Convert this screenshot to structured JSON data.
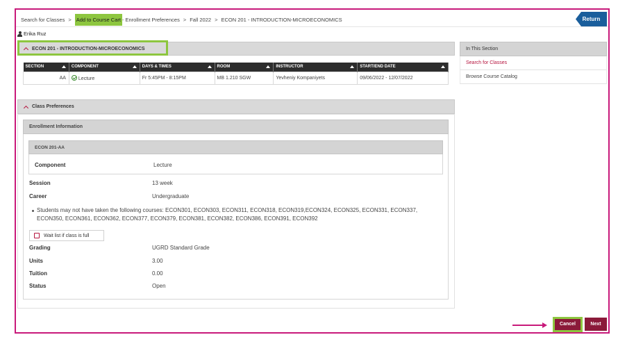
{
  "breadcrumb": {
    "items": [
      "Search for Classes",
      "Add to Course Cart",
      "Enrollment Preferences",
      "Fall 2022",
      "ECON  201 - INTRODUCTION-MICROECONOMICS"
    ],
    "separators": [
      ">",
      "-",
      ">",
      ">"
    ]
  },
  "return_label": "Return",
  "user_name": "Erika Ruz",
  "course_section": {
    "title": "ECON  201 - INTRODUCTION-MICROECONOMICS",
    "columns": [
      "SECTION",
      "COMPONENT",
      "DAYS & TIMES",
      "ROOM",
      "INSTRUCTOR",
      "START/END DATE"
    ],
    "row": {
      "section": "AA",
      "component": "Lecture",
      "days_times": "Fr 5:45PM - 8:15PM",
      "room": "MB 1.210 SGW",
      "instructor": "Yevheniy Kompaniyets",
      "dates": "09/06/2022 - 12/07/2022"
    }
  },
  "class_preferences": {
    "title": "Class Preferences",
    "enrollment_info_title": "Enrollment Information",
    "class_id": "ECON  201-AA",
    "component_label": "Component",
    "component_value": "Lecture",
    "session_label": "Session",
    "session_value": "13 week",
    "career_label": "Career",
    "career_value": "Undergraduate",
    "requirement_text": "Students may not have taken the following courses: ECON301, ECON303, ECON311, ECON318, ECON319,ECON324, ECON325, ECON331, ECON337, ECON350, ECON361, ECON362, ECON377, ECON379, ECON381, ECON382, ECON386, ECON391, ECON392",
    "waitlist_label": "Wait list if class is full",
    "grading_label": "Grading",
    "grading_value": "UGRD Standard Grade",
    "units_label": "Units",
    "units_value": "3.00",
    "tuition_label": "Tuition",
    "tuition_value": "0.00",
    "status_label": "Status",
    "status_value": "Open"
  },
  "side_panel": {
    "title": "In This Section",
    "items": [
      "Search for Classes",
      "Browse Course Catalog"
    ]
  },
  "buttons": {
    "cancel": "Cancel",
    "next": "Next"
  },
  "colors": {
    "accent": "#8b1a3a",
    "highlight": "#8dc63f",
    "annotation": "#c8197a",
    "return_button": "#1a5e9c"
  }
}
